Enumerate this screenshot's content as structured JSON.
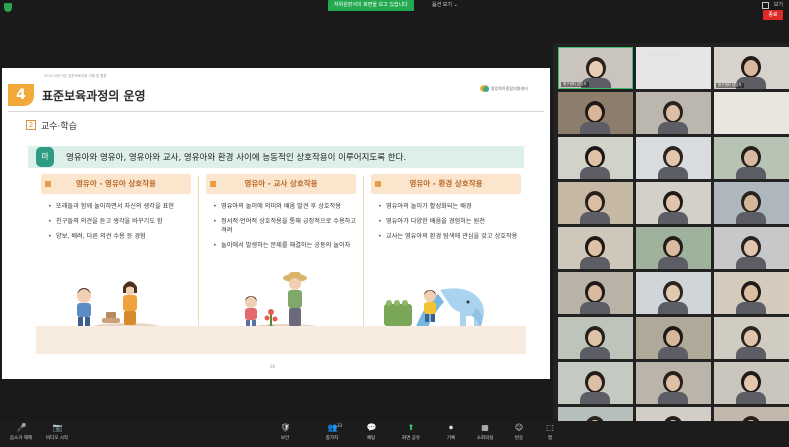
{
  "topbar": {
    "share_banner": "자위원장서의 화면을 보고 있습니다",
    "view_options": "옵션 보기 ⌄",
    "view_label": "보기"
  },
  "slide": {
    "subtitle": "2024 어린이집 표준보육과정 이해 및 활용",
    "number": "4",
    "title": "표준보육과정의 운영",
    "center_name": "중앙육아종합지원센터",
    "section_num": "2",
    "section_label": "교수·학습",
    "principle_badge": "마",
    "principle_text": "영유아와 영유아, 영유아와 교사, 영유아와 환경 사이에 능동적인 상호작용이 이루어지도록 한다.",
    "panels": [
      {
        "title": "영유아 - 영유아 상호작용",
        "bullets": [
          "또래들과 함께 놀이하면서 자신의 생각을 표현",
          "친구들의 의견을 듣고 생각을 바꾸기도 함",
          "양보, 배려, 다른 의견 수용 등 경험"
        ]
      },
      {
        "title": "영유아 - 교사 상호작용",
        "bullets": [
          "영유아의 놀이에 의미와 배움 발견 후 상호작용",
          "정서적·언어적 상호작용을 통해 긍정적으로 수용하고 격려",
          "놀이에서 발생하는 문제를 해결하는 공동의 놀이자"
        ]
      },
      {
        "title": "영유아 - 환경 상호작용",
        "bullets": [
          "영유아의 놀이가 활성화되는 배경",
          "영유아가 다양한 배움을 경험하는 원천",
          "교사는 영유아의 환경 탐색에 관심을 갖고 상호작용"
        ]
      }
    ],
    "page_number": "26"
  },
  "gallery": {
    "header_label": "중구센터 담당자",
    "tiles": [
      {
        "label": "중구센터 담당자",
        "bg": "#c9c4bd",
        "skin": "#e8cdb5",
        "hair": "#2a211c",
        "speaker": true
      },
      {
        "label": "",
        "bg": "#e6e6e6",
        "skin": "",
        "hair": "",
        "speaker": false
      },
      {
        "label": "동구센터 담당자",
        "bg": "#d7d3cc",
        "skin": "#d9b89d",
        "hair": "#221b17",
        "speaker": false
      },
      {
        "label": "",
        "bg": "#8c7d6c",
        "skin": "#d7b596",
        "hair": "#1e1915",
        "speaker": false
      },
      {
        "label": "",
        "bg": "#bcb7ae",
        "skin": "#dcbfa6",
        "hair": "#2b221c",
        "speaker": false
      },
      {
        "label": "",
        "bg": "#e9e6df",
        "skin": "",
        "hair": "",
        "speaker": false
      },
      {
        "label": "",
        "bg": "#cfd3c8",
        "skin": "#dfc2a8",
        "hair": "#1b1714",
        "speaker": false
      },
      {
        "label": "",
        "bg": "#d9dde0",
        "skin": "#e2c7ae",
        "hair": "#2c241f",
        "speaker": false
      },
      {
        "label": "",
        "bg": "#b7c3b3",
        "skin": "#d8b99f",
        "hair": "#241e1a",
        "speaker": false
      },
      {
        "label": "",
        "bg": "#c5b9a6",
        "skin": "#dcbda3",
        "hair": "#261f1a",
        "speaker": false
      },
      {
        "label": "",
        "bg": "#d3d0c8",
        "skin": "#e0c4ab",
        "hair": "#1f1a16",
        "speaker": false
      },
      {
        "label": "",
        "bg": "#aeb7bd",
        "skin": "#d6b69b",
        "hair": "#2a221d",
        "speaker": false
      },
      {
        "label": "",
        "bg": "#cfc7b9",
        "skin": "#dec1a7",
        "hair": "#1d1814",
        "speaker": false
      },
      {
        "label": "",
        "bg": "#9fb39c",
        "skin": "#dabb9f",
        "hair": "#231d19",
        "speaker": false
      },
      {
        "label": "",
        "bg": "#c8c8c8",
        "skin": "#e1c6ad",
        "hair": "#292220",
        "speaker": false
      },
      {
        "label": "",
        "bg": "#b9b2a7",
        "skin": "#d9ba9f",
        "hair": "#201a17",
        "speaker": false
      },
      {
        "label": "",
        "bg": "#cfd5d8",
        "skin": "#e3c8b0",
        "hair": "#2b2420",
        "speaker": false
      },
      {
        "label": "",
        "bg": "#d4cbbd",
        "skin": "#dbbda2",
        "hair": "#221c18",
        "speaker": false
      },
      {
        "label": "",
        "bg": "#bfc4bb",
        "skin": "#dfc3a9",
        "hair": "#251f1b",
        "speaker": false
      },
      {
        "label": "",
        "bg": "#b0a898",
        "skin": "#d7b79c",
        "hair": "#1e1916",
        "speaker": false
      },
      {
        "label": "",
        "bg": "#d1ccc2",
        "skin": "#e0c5ac",
        "hair": "#2a231e",
        "speaker": false
      },
      {
        "label": "",
        "bg": "#c4cac2",
        "skin": "#dcbea4",
        "hair": "#231e1a",
        "speaker": false
      },
      {
        "label": "",
        "bg": "#bbb4a8",
        "skin": "#ddc0a6",
        "hair": "#27201c",
        "speaker": false
      },
      {
        "label": "",
        "bg": "#cac6bd",
        "skin": "#e2c6ad",
        "hair": "#1f1a17",
        "speaker": false
      },
      {
        "label": "",
        "bg": "#b6bfb9",
        "skin": "#d8b99e",
        "hair": "#29221e",
        "speaker": false
      },
      {
        "label": "",
        "bg": "#d2cec6",
        "skin": "#dec2a8",
        "hair": "#221d19",
        "speaker": false
      },
      {
        "label": "",
        "bg": "#c1b8ab",
        "skin": "#dbbda2",
        "hair": "#26201b",
        "speaker": false
      }
    ]
  },
  "toolbar": {
    "items": [
      {
        "label": "음소거 해제",
        "icon": "🎤"
      },
      {
        "label": "비디오 시작",
        "icon": "📷"
      },
      {
        "label": "보안",
        "icon": "🛡"
      },
      {
        "label": "참가자",
        "icon": "👥",
        "count": "33"
      },
      {
        "label": "채팅",
        "icon": "💬"
      },
      {
        "label": "화면 공유",
        "icon": "⬆"
      },
      {
        "label": "기록",
        "icon": "⏺"
      },
      {
        "label": "소회의실",
        "icon": "▦"
      },
      {
        "label": "반응",
        "icon": "☺"
      },
      {
        "label": "앱",
        "icon": "⬚"
      }
    ],
    "end_label": "종료"
  },
  "colors": {
    "accent_green": "#23a94f",
    "slide_orange": "#f2a93b",
    "principle_teal": "#2f9b82",
    "end_red": "#e02828"
  }
}
